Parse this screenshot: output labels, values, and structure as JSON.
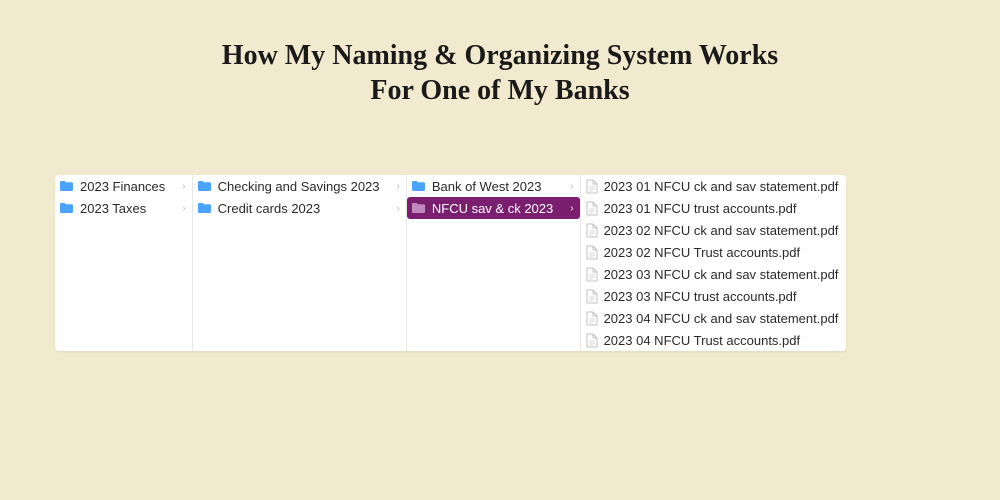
{
  "title_line1": "How My Naming & Organizing System Works",
  "title_line2": "For One of My Banks",
  "colors": {
    "selection": "#7a1f6f",
    "folder": "#4aa3ff",
    "folder_selected": "#c189bb",
    "background": "#f2eacf"
  },
  "columns": [
    {
      "items": [
        {
          "type": "folder",
          "label": "2023 Finances",
          "has_children": true,
          "selected": false
        },
        {
          "type": "folder",
          "label": "2023 Taxes",
          "has_children": true,
          "selected": false
        }
      ]
    },
    {
      "items": [
        {
          "type": "folder",
          "label": "Checking and Savings 2023",
          "has_children": true,
          "selected": false
        },
        {
          "type": "folder",
          "label": "Credit cards 2023",
          "has_children": true,
          "selected": false
        }
      ]
    },
    {
      "items": [
        {
          "type": "folder",
          "label": "Bank of West 2023",
          "has_children": true,
          "selected": false
        },
        {
          "type": "folder",
          "label": "NFCU sav & ck 2023",
          "has_children": true,
          "selected": true
        }
      ]
    },
    {
      "items": [
        {
          "type": "file",
          "label": "2023 01 NFCU ck and sav statement.pdf"
        },
        {
          "type": "file",
          "label": "2023 01 NFCU trust accounts.pdf"
        },
        {
          "type": "file",
          "label": "2023 02 NFCU ck and sav statement.pdf"
        },
        {
          "type": "file",
          "label": "2023 02 NFCU Trust accounts.pdf"
        },
        {
          "type": "file",
          "label": "2023 03 NFCU ck and sav statement.pdf"
        },
        {
          "type": "file",
          "label": "2023 03 NFCU trust accounts.pdf"
        },
        {
          "type": "file",
          "label": "2023 04 NFCU ck and sav statement.pdf"
        },
        {
          "type": "file",
          "label": "2023 04 NFCU Trust accounts.pdf"
        }
      ]
    }
  ]
}
